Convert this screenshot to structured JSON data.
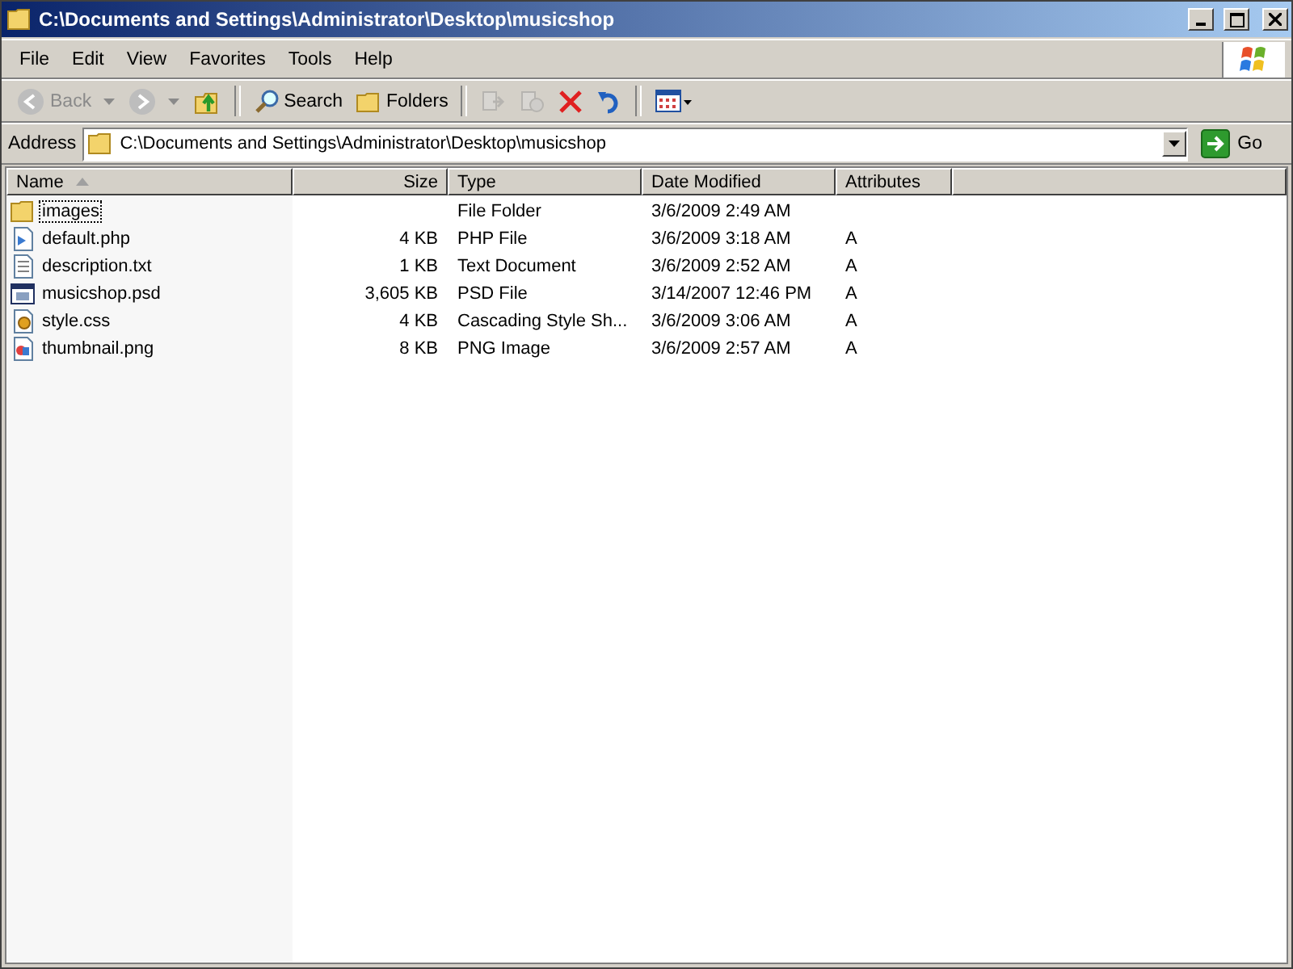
{
  "window": {
    "title": "C:\\Documents and Settings\\Administrator\\Desktop\\musicshop"
  },
  "menu": [
    "File",
    "Edit",
    "View",
    "Favorites",
    "Tools",
    "Help"
  ],
  "toolbar": [
    {
      "kind": "back",
      "label": "Back",
      "disabled": true
    },
    {
      "kind": "forward",
      "disabled": true
    },
    {
      "kind": "up"
    },
    {
      "kind": "sep"
    },
    {
      "kind": "search",
      "label": "Search"
    },
    {
      "kind": "folders",
      "label": "Folders"
    },
    {
      "kind": "sep"
    },
    {
      "kind": "moveto",
      "disabled": true
    },
    {
      "kind": "copyto",
      "disabled": true
    },
    {
      "kind": "delete"
    },
    {
      "kind": "undo"
    },
    {
      "kind": "sep"
    },
    {
      "kind": "views"
    }
  ],
  "address": {
    "label": "Address",
    "value": "C:\\Documents and Settings\\Administrator\\Desktop\\musicshop",
    "go": "Go"
  },
  "table": {
    "columns": [
      {
        "label": "Name",
        "sorted": true
      },
      {
        "label": "Size",
        "sorted": false
      },
      {
        "label": "Type",
        "sorted": false
      },
      {
        "label": "Date Modified",
        "sorted": false
      },
      {
        "label": "Attributes",
        "sorted": false
      }
    ],
    "rows": [
      {
        "kind": "folder",
        "focused": true,
        "cells": [
          "images",
          "",
          "File Folder",
          "3/6/2009 2:49 AM",
          ""
        ]
      },
      {
        "kind": "php",
        "focused": false,
        "cells": [
          "default.php",
          "4 KB",
          "PHP File",
          "3/6/2009 3:18 AM",
          "A"
        ]
      },
      {
        "kind": "text",
        "focused": false,
        "cells": [
          "description.txt",
          "1 KB",
          "Text Document",
          "3/6/2009 2:52 AM",
          "A"
        ]
      },
      {
        "kind": "psd",
        "focused": false,
        "cells": [
          "musicshop.psd",
          "3,605 KB",
          "PSD File",
          "3/14/2007 12:46 PM",
          "A"
        ]
      },
      {
        "kind": "css",
        "focused": false,
        "cells": [
          "style.css",
          "4 KB",
          "Cascading Style Sh...",
          "3/6/2009 3:06 AM",
          "A"
        ]
      },
      {
        "kind": "image",
        "focused": false,
        "cells": [
          "thumbnail.png",
          "8 KB",
          "PNG Image",
          "3/6/2009 2:57 AM",
          "A"
        ]
      }
    ]
  }
}
